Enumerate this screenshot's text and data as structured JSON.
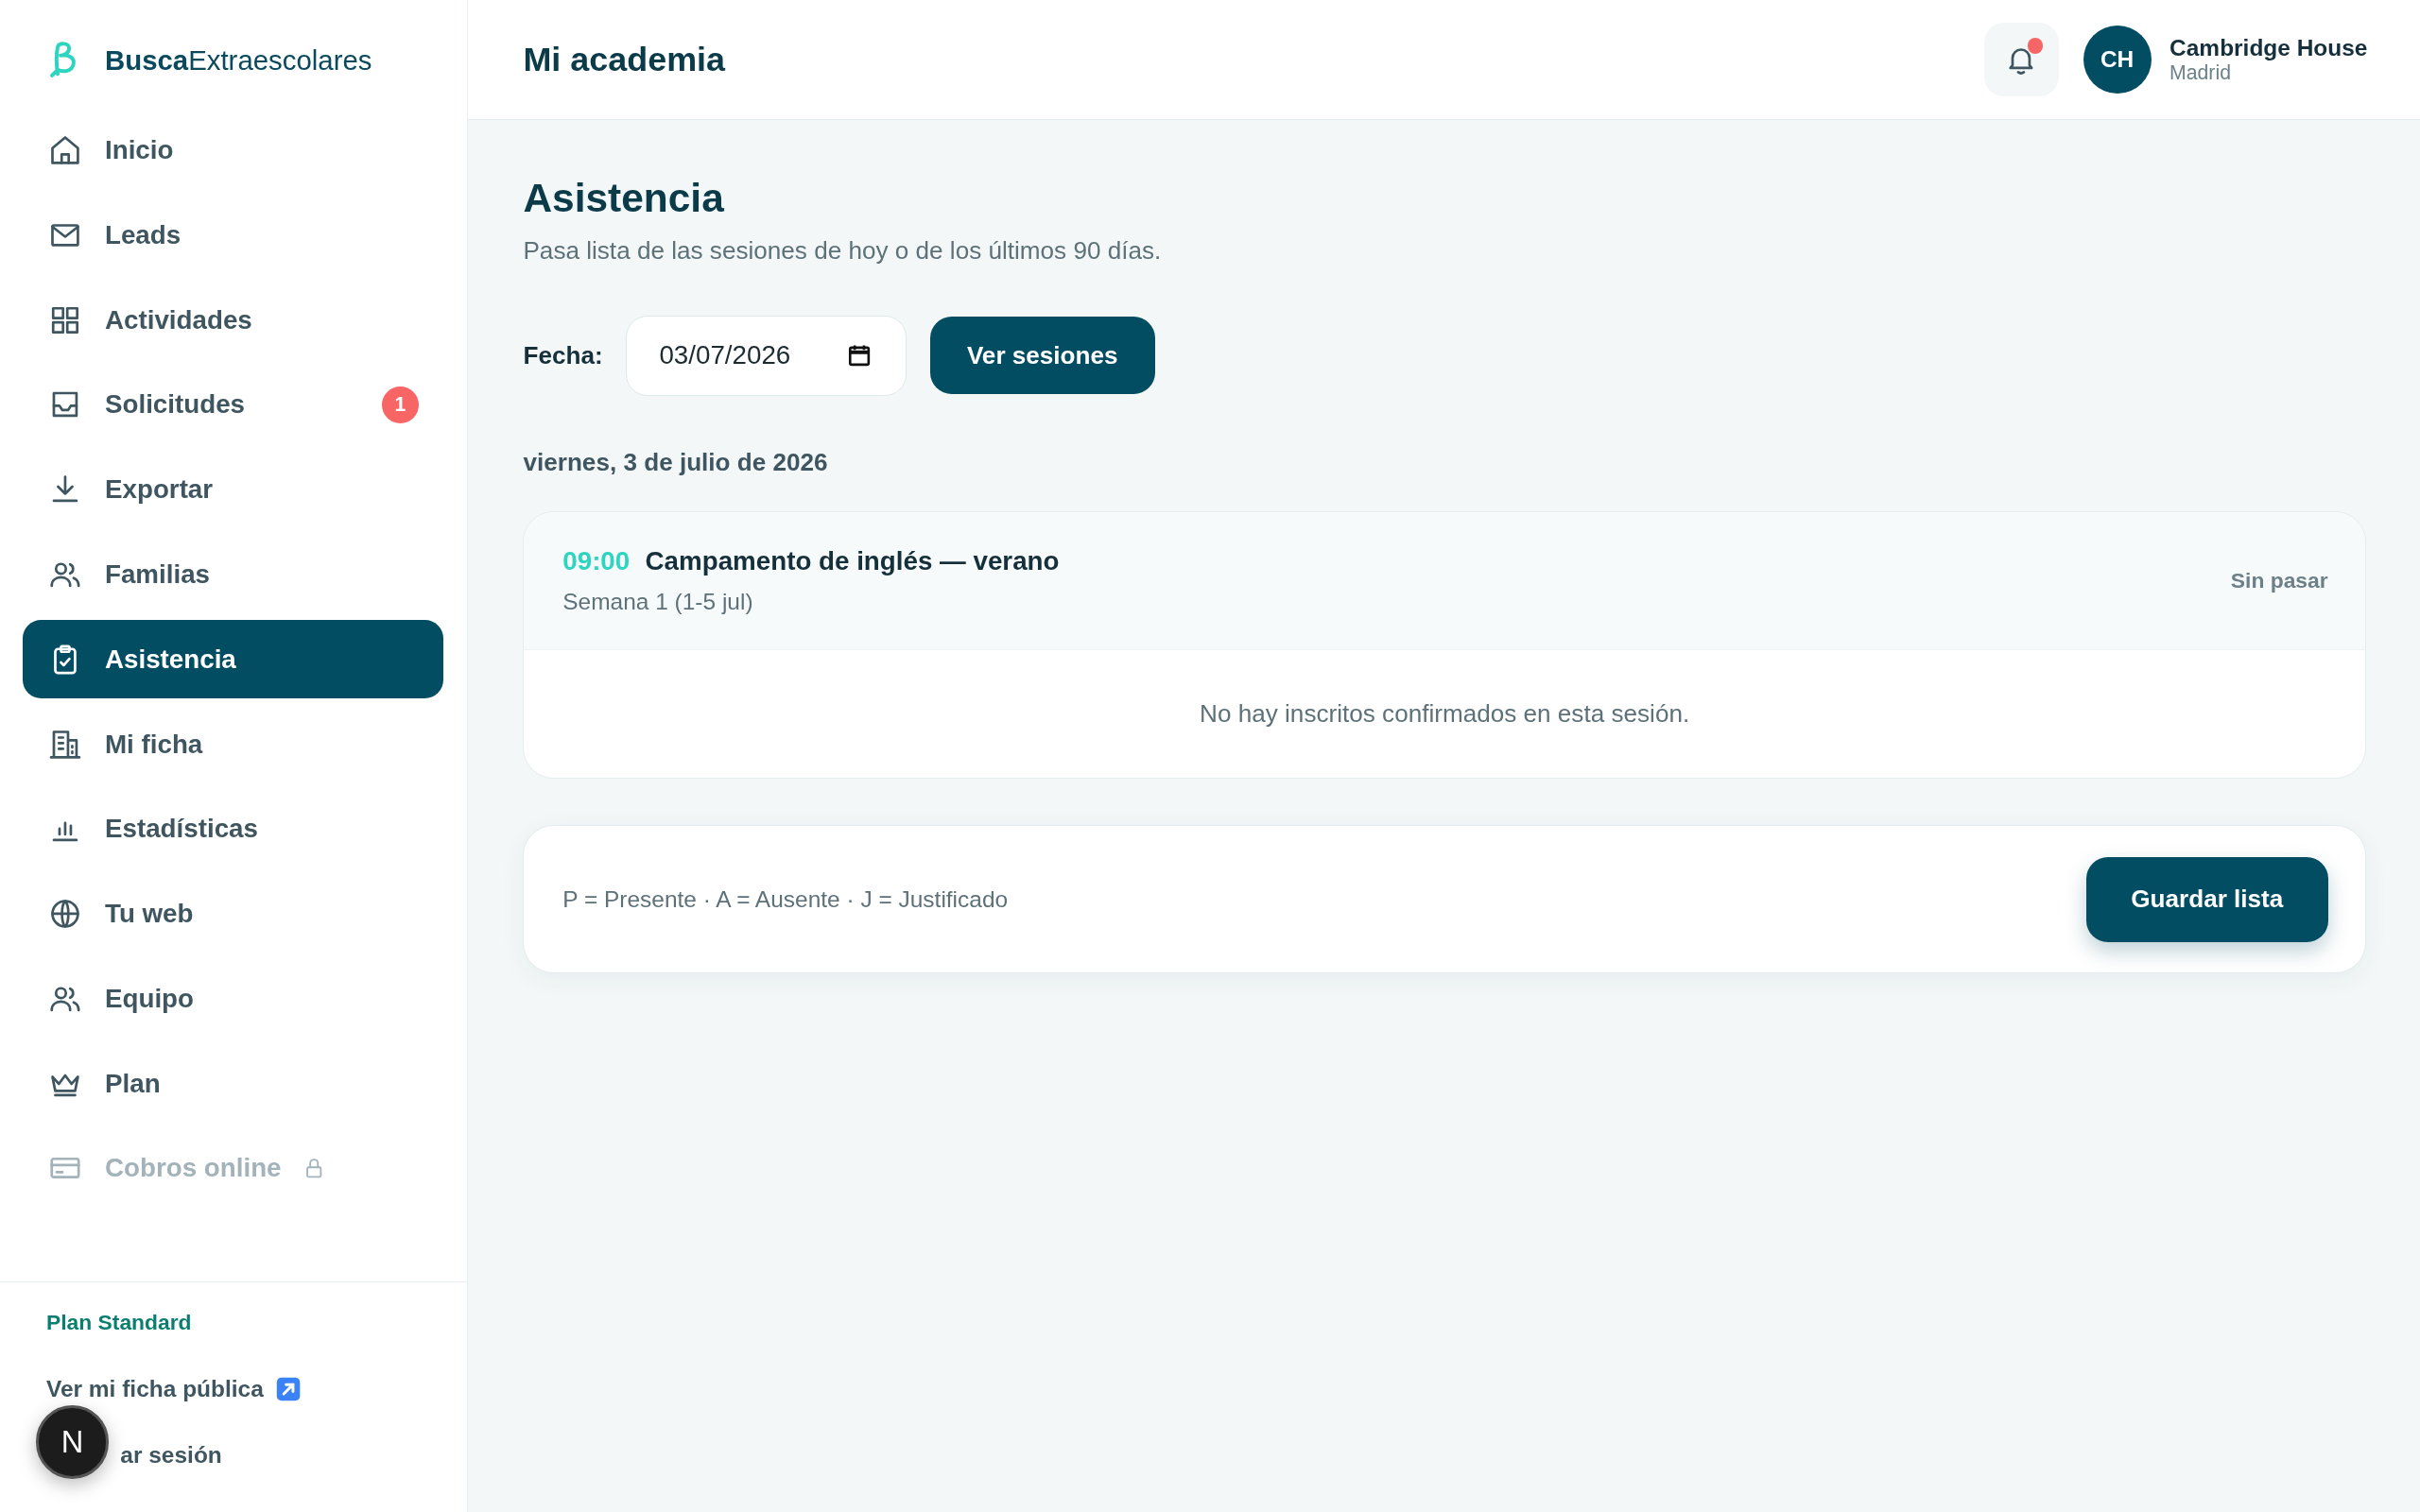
{
  "brand": {
    "bold": "Busca",
    "regular": "Extraescolares"
  },
  "sidebar": {
    "items": [
      {
        "label": "Inicio",
        "selected": false,
        "disabled": false
      },
      {
        "label": "Leads",
        "selected": false,
        "disabled": false
      },
      {
        "label": "Actividades",
        "selected": false,
        "disabled": false
      },
      {
        "label": "Solicitudes",
        "selected": false,
        "disabled": false,
        "badge": "1"
      },
      {
        "label": "Exportar",
        "selected": false,
        "disabled": false
      },
      {
        "label": "Familias",
        "selected": false,
        "disabled": false
      },
      {
        "label": "Asistencia",
        "selected": true,
        "disabled": false
      },
      {
        "label": "Mi ficha",
        "selected": false,
        "disabled": false
      },
      {
        "label": "Estadísticas",
        "selected": false,
        "disabled": false
      },
      {
        "label": "Tu web",
        "selected": false,
        "disabled": false
      },
      {
        "label": "Equipo",
        "selected": false,
        "disabled": false
      },
      {
        "label": "Plan",
        "selected": false,
        "disabled": false
      },
      {
        "label": "Cobros online",
        "selected": false,
        "disabled": true
      }
    ],
    "plan": "Plan Standard",
    "public_link": "Ver mi ficha pública",
    "logout": "ar sesión"
  },
  "header": {
    "title": "Mi academia",
    "notifications": {
      "unread": true
    },
    "user": {
      "initials": "CH",
      "name": "Cambridge House",
      "city": "Madrid"
    }
  },
  "page": {
    "title": "Asistencia",
    "subtitle": "Pasa lista de las sesiones de hoy o de los últimos 90 días.",
    "filter": {
      "label": "Fecha:",
      "value": "03/07/2026",
      "button": "Ver sesiones"
    },
    "date_heading": "viernes, 3 de julio de 2026",
    "sessions": [
      {
        "time": "09:00",
        "title": "Campamento de inglés — verano",
        "subtitle": "Semana 1 (1-5 jul)",
        "status": "Sin pasar",
        "empty_message": "No hay inscritos confirmados en esta sesión."
      }
    ],
    "legend": "P = Presente · A = Ausente · J = Justificado",
    "save_button": "Guardar lista"
  },
  "dev_badge": "N"
}
